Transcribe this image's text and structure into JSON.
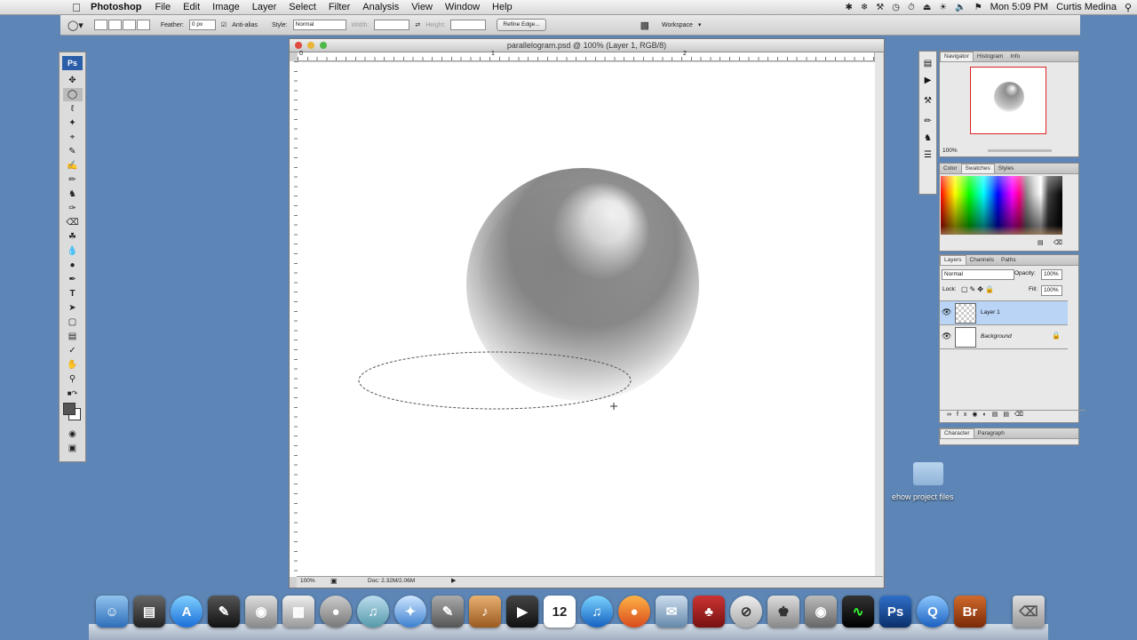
{
  "menubar": {
    "app_name": "Photoshop",
    "menus": [
      "File",
      "Edit",
      "Image",
      "Layer",
      "Select",
      "Filter",
      "Analysis",
      "View",
      "Window",
      "Help"
    ],
    "clock": "Mon 5:09 PM",
    "user": "Curtis Medina"
  },
  "options_bar": {
    "feather_label": "Feather:",
    "feather_value": "0 px",
    "antialias_label": "Anti-alias",
    "style_label": "Style:",
    "style_value": "Normal",
    "width_label": "Width:",
    "height_label": "Height:",
    "refine_edge": "Refine Edge...",
    "workspace": "Workspace"
  },
  "toolbox": {
    "logo": "Ps"
  },
  "document": {
    "title": "parallelogram.psd @ 100% (Layer 1, RGB/8)",
    "zoom": "100%",
    "doc_size": "Doc: 2.32M/2.06M",
    "ruler_labels": [
      "0",
      "1",
      "2"
    ]
  },
  "navigator": {
    "tabs": [
      "Navigator",
      "Histogram",
      "Info"
    ],
    "zoom": "100%"
  },
  "swatches_panel": {
    "tabs": [
      "Color",
      "Swatches",
      "Styles"
    ]
  },
  "layers_panel": {
    "tabs": [
      "Layers",
      "Channels",
      "Paths"
    ],
    "blend_mode": "Normal",
    "opacity_label": "Opacity:",
    "opacity_value": "100%",
    "lock_label": "Lock:",
    "fill_label": "Fill:",
    "fill_value": "100%",
    "layers": [
      {
        "name": "Layer 1",
        "selected": true
      },
      {
        "name": "Background",
        "selected": false
      }
    ]
  },
  "character_panel": {
    "tabs": [
      "Character",
      "Paragraph"
    ]
  },
  "desktop": {
    "folder_label": "ehow project files"
  },
  "dock": {
    "items": [
      "finder-icon",
      "photo-booth-icon",
      "app-store-icon",
      "final-cut-icon",
      "aperture-icon",
      "preview-icon",
      "dvd-player-icon",
      "itunes-disc-icon",
      "safari-icon",
      "script-editor-icon",
      "garageband-icon",
      "imovie-icon",
      "calendar-icon",
      "itunes-icon",
      "firefox-icon",
      "mail-icon",
      "wine-icon",
      "stopwatch-icon",
      "ftp-icon",
      "camera-icon",
      "activity-monitor-icon",
      "photoshop-icon",
      "quicktime-icon",
      "bridge-icon",
      "trash-icon"
    ],
    "calendar_day": "12",
    "ps_label": "Ps",
    "br_label": "Br"
  }
}
